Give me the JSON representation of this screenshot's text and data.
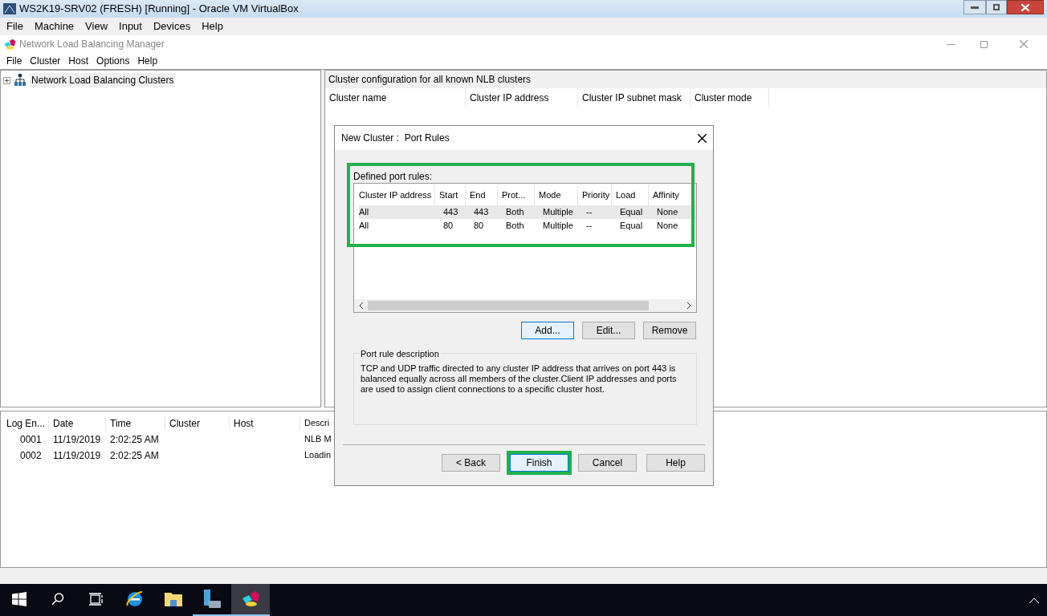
{
  "vm_window": {
    "title": "WS2K19-SRV02 (FRESH) [Running] - Oracle VM VirtualBox",
    "menu": [
      "File",
      "Machine",
      "View",
      "Input",
      "Devices",
      "Help"
    ]
  },
  "app_window": {
    "title": "Network Load Balancing Manager",
    "menu": [
      "File",
      "Cluster",
      "Host",
      "Options",
      "Help"
    ]
  },
  "tree": {
    "items": [
      {
        "label": "Network Load Balancing Clusters",
        "expanded": false
      }
    ]
  },
  "clusters_pane": {
    "caption": "Cluster configuration for all known NLB clusters",
    "columns": [
      "Cluster name",
      "Cluster IP address",
      "Cluster IP subnet mask",
      "Cluster mode"
    ]
  },
  "log": {
    "columns": [
      "Log En...",
      "Date",
      "Time",
      "Cluster",
      "Host",
      "Descri"
    ],
    "rows": [
      [
        "0001",
        "11/19/2019",
        "2:02:25 AM",
        "",
        "",
        "NLB M"
      ],
      [
        "0002",
        "11/19/2019",
        "2:02:25 AM",
        "",
        "",
        "Loadin"
      ]
    ]
  },
  "dialog": {
    "title": "New Cluster :  Port Rules",
    "port_rules": {
      "label": "Defined port rules:",
      "highlighted": true,
      "columns": [
        "Cluster IP address",
        "Start",
        "End",
        "Prot...",
        "Mode",
        "Priority",
        "Load",
        "Affinity"
      ],
      "rows": [
        {
          "cells": [
            "All",
            "443",
            "443",
            "Both",
            "Multiple",
            "--",
            "Equal",
            "None"
          ],
          "selected": true
        },
        {
          "cells": [
            "All",
            "80",
            "80",
            "Both",
            "Multiple",
            "--",
            "Equal",
            "None"
          ],
          "selected": false
        }
      ]
    },
    "rule_buttons": [
      {
        "label": "Add...",
        "default": true
      },
      {
        "label": "Edit...",
        "default": false
      },
      {
        "label": "Remove",
        "default": false
      }
    ],
    "description": {
      "legend": "Port rule description",
      "text": "TCP and UDP traffic directed to any cluster IP address that arrives on port 443 is balanced equally across all members of the cluster.Client IP addresses and ports are used to assign client connections to a specific cluster host."
    },
    "footer_buttons": [
      {
        "label": "< Back",
        "default": false,
        "highlighted": false
      },
      {
        "label": "Finish",
        "default": true,
        "highlighted": true
      },
      {
        "label": "Cancel",
        "default": false,
        "highlighted": false
      },
      {
        "label": "Help",
        "default": false,
        "highlighted": false
      }
    ]
  },
  "taskbar": {
    "items": [
      {
        "kind": "start",
        "running": false,
        "selected": false
      },
      {
        "kind": "search",
        "running": false,
        "selected": false
      },
      {
        "kind": "taskview",
        "running": false,
        "selected": false
      },
      {
        "kind": "browser",
        "running": false,
        "selected": false
      },
      {
        "kind": "folder",
        "running": false,
        "selected": false
      },
      {
        "kind": "server",
        "running": true,
        "selected": false
      },
      {
        "kind": "nlb",
        "running": true,
        "selected": true
      }
    ]
  }
}
